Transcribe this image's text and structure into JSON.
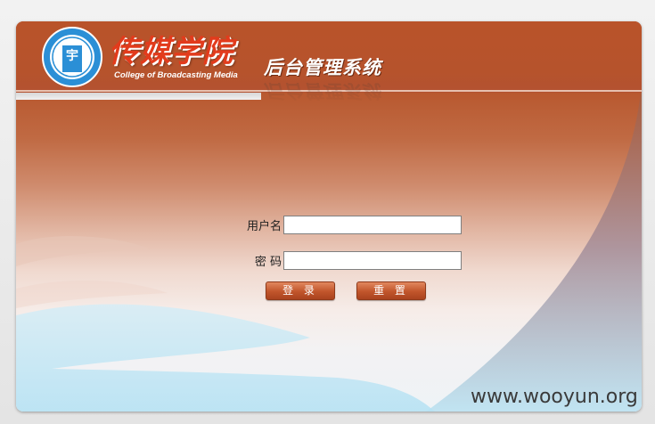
{
  "header": {
    "logo_cn": "传媒学院",
    "logo_en": "College of Broadcasting Media",
    "system_title": "后台管理系统",
    "emblem_char": "宇"
  },
  "form": {
    "username_label": "用户名",
    "password_label": "密 码",
    "username_value": "",
    "password_value": "",
    "login_label": "登 录",
    "reset_label": "重 置"
  },
  "watermark": "www.wooyun.org",
  "colors": {
    "header": "#b6532c",
    "button": "#c1552b",
    "logo_text": "#e23b1c",
    "sky_blue": "#bfe7f6"
  }
}
